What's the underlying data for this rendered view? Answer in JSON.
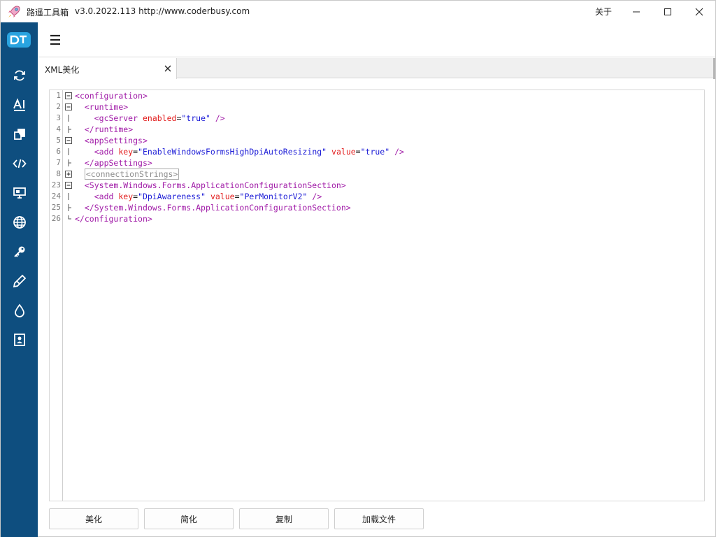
{
  "titlebar": {
    "app_name": "路遥工具箱",
    "version_url": "v3.0.2022.113  http://www.coderbusy.com",
    "about_label": "关于"
  },
  "sidebar": {
    "items": [
      {
        "icon": "refresh-icon"
      },
      {
        "icon": "ai-text-icon"
      },
      {
        "icon": "copy-icon"
      },
      {
        "icon": "code-icon"
      },
      {
        "icon": "monitor-icon"
      },
      {
        "icon": "globe-icon"
      },
      {
        "icon": "key-icon"
      },
      {
        "icon": "brush-icon"
      },
      {
        "icon": "drop-icon"
      },
      {
        "icon": "image-frame-icon"
      }
    ],
    "colors": {
      "background": "#0e4e7f",
      "logo": "#29a3e0"
    }
  },
  "tab": {
    "label": "XML美化"
  },
  "editor": {
    "lines": [
      {
        "num": "1",
        "fold": "minus",
        "indent": "",
        "parts": [
          [
            "tag",
            "<"
          ],
          [
            "name",
            "configuration"
          ],
          [
            "tag",
            ">"
          ]
        ]
      },
      {
        "num": "2",
        "fold": "minus",
        "indent": "  ",
        "parts": [
          [
            "tag",
            "<"
          ],
          [
            "name",
            "runtime"
          ],
          [
            "tag",
            ">"
          ]
        ]
      },
      {
        "num": "3",
        "fold": "line",
        "indent": "    ",
        "parts": [
          [
            "tag",
            "<"
          ],
          [
            "name",
            "gcServer"
          ],
          [
            "sp",
            " "
          ],
          [
            "attr",
            "enabled"
          ],
          [
            "eq",
            "="
          ],
          [
            "val",
            "\"true\""
          ],
          [
            "sp",
            " "
          ],
          [
            "tag",
            "/>"
          ]
        ]
      },
      {
        "num": "4",
        "fold": "end",
        "indent": "  ",
        "parts": [
          [
            "tag",
            "</"
          ],
          [
            "name",
            "runtime"
          ],
          [
            "tag",
            ">"
          ]
        ]
      },
      {
        "num": "5",
        "fold": "minus",
        "indent": "  ",
        "parts": [
          [
            "tag",
            "<"
          ],
          [
            "name",
            "appSettings"
          ],
          [
            "tag",
            ">"
          ]
        ]
      },
      {
        "num": "6",
        "fold": "line",
        "indent": "    ",
        "parts": [
          [
            "tag",
            "<"
          ],
          [
            "name",
            "add"
          ],
          [
            "sp",
            " "
          ],
          [
            "attr",
            "key"
          ],
          [
            "eq",
            "="
          ],
          [
            "val",
            "\"EnableWindowsFormsHighDpiAutoResizing\""
          ],
          [
            "sp",
            " "
          ],
          [
            "attr",
            "value"
          ],
          [
            "eq",
            "="
          ],
          [
            "val",
            "\"true\""
          ],
          [
            "sp",
            " "
          ],
          [
            "tag",
            "/>"
          ]
        ]
      },
      {
        "num": "7",
        "fold": "end",
        "indent": "  ",
        "parts": [
          [
            "tag",
            "</"
          ],
          [
            "name",
            "appSettings"
          ],
          [
            "tag",
            ">"
          ]
        ]
      },
      {
        "num": "8",
        "fold": "plus",
        "indent": "  ",
        "parts": [
          [
            "collapsed",
            "<connectionStrings>"
          ]
        ]
      },
      {
        "num": "23",
        "fold": "minus",
        "indent": "  ",
        "parts": [
          [
            "tag",
            "<"
          ],
          [
            "name",
            "System.Windows.Forms.ApplicationConfigurationSection"
          ],
          [
            "tag",
            ">"
          ]
        ]
      },
      {
        "num": "24",
        "fold": "line",
        "indent": "    ",
        "parts": [
          [
            "tag",
            "<"
          ],
          [
            "name",
            "add"
          ],
          [
            "sp",
            " "
          ],
          [
            "attr",
            "key"
          ],
          [
            "eq",
            "="
          ],
          [
            "val",
            "\"DpiAwareness\""
          ],
          [
            "sp",
            " "
          ],
          [
            "attr",
            "value"
          ],
          [
            "eq",
            "="
          ],
          [
            "val",
            "\"PerMonitorV2\""
          ],
          [
            "sp",
            " "
          ],
          [
            "tag",
            "/>"
          ]
        ]
      },
      {
        "num": "25",
        "fold": "end",
        "indent": "  ",
        "parts": [
          [
            "tag",
            "</"
          ],
          [
            "name",
            "System.Windows.Forms.ApplicationConfigurationSection"
          ],
          [
            "tag",
            ">"
          ]
        ]
      },
      {
        "num": "26",
        "fold": "last",
        "indent": "",
        "parts": [
          [
            "tag",
            "</"
          ],
          [
            "name",
            "configuration"
          ],
          [
            "tag",
            ">"
          ]
        ]
      }
    ],
    "colors": {
      "tag": "#a01aa7",
      "attr": "#e21b1b",
      "value": "#1b1bd6",
      "line_number": "#7a7a7a"
    }
  },
  "buttons": {
    "beautify": "美化",
    "simplify": "简化",
    "copy": "复制",
    "load_file": "加载文件"
  }
}
